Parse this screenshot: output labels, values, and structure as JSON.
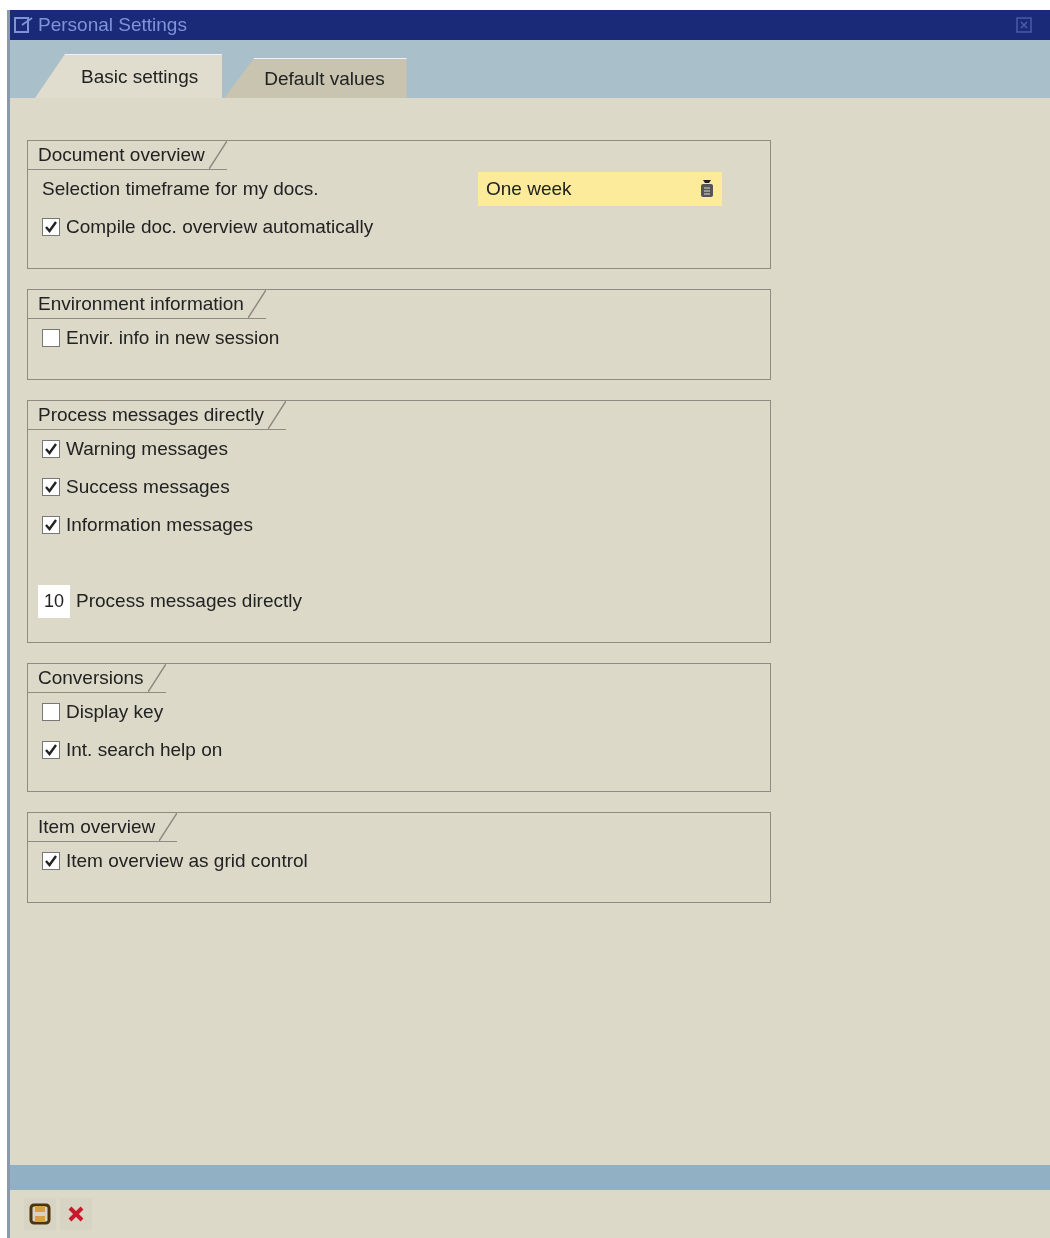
{
  "window": {
    "title": "Personal Settings"
  },
  "tabs": [
    {
      "label": "Basic settings",
      "selected": true
    },
    {
      "label": "Default values",
      "selected": false
    }
  ],
  "groups": [
    {
      "title": "Document overview",
      "items": [
        {
          "kind": "dropdown",
          "label": "Selection timeframe for my docs.",
          "value": "One week"
        },
        {
          "kind": "checkbox",
          "label": "Compile doc. overview automatically",
          "checked": true
        }
      ]
    },
    {
      "title": "Environment information",
      "items": [
        {
          "kind": "checkbox",
          "label": "Envir. info in new session",
          "checked": false
        }
      ]
    },
    {
      "title": "Process messages directly",
      "items": [
        {
          "kind": "checkbox",
          "label": "Warning messages",
          "checked": true
        },
        {
          "kind": "checkbox",
          "label": "Success messages",
          "checked": true
        },
        {
          "kind": "checkbox",
          "label": "Information messages",
          "checked": true
        },
        {
          "kind": "number",
          "value": "10",
          "label": "Process messages directly"
        }
      ]
    },
    {
      "title": "Conversions",
      "items": [
        {
          "kind": "checkbox",
          "label": "Display key",
          "checked": false
        },
        {
          "kind": "checkbox",
          "label": "Int. search help on",
          "checked": true
        }
      ]
    },
    {
      "title": "Item overview",
      "items": [
        {
          "kind": "checkbox",
          "label": "Item overview as grid control",
          "checked": true
        }
      ]
    }
  ]
}
